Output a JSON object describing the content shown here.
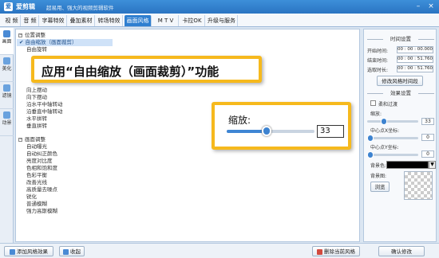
{
  "app": {
    "logo_char": "爱",
    "name": "爱剪辑",
    "slogan": "超易用、强大的视频剪辑软件",
    "min_symbol": "–",
    "close_symbol": "×"
  },
  "menu_tabs": [
    "视 频",
    "音 频",
    "字幕特效",
    "叠加素材",
    "转场特效",
    "画面风格",
    "M T V",
    "卡拉OK",
    "升级与服务"
  ],
  "active_menu_tab": "画面风格",
  "side_tabs": [
    {
      "label": "画面",
      "icon": "picture-icon"
    },
    {
      "label": "美化",
      "icon": "beautify-icon"
    },
    {
      "label": "滤镜",
      "icon": "filter-icon"
    },
    {
      "label": "动景",
      "icon": "motion-icon"
    }
  ],
  "effect_list": {
    "group1": {
      "label": "位置调整",
      "toggle": "−"
    },
    "selected_item": "自由缩放（画面裁剪）",
    "selected_check": "✔",
    "partial_item": "自由旋转",
    "group1_items": [
      "向上摆动",
      "向下摆动",
      "沿水平中轴转动",
      "沿垂直中轴转动",
      "水平拼转",
      "垂直拼转"
    ],
    "group2": {
      "label": "画面调整",
      "toggle": "−"
    },
    "group2_items": [
      "自动曝光",
      "自动纠正颜色",
      "亮度对比度",
      "色相和饱和度",
      "色彩平衡",
      "改善光线",
      "高质量去噪点",
      "锐化",
      "普通模糊",
      "强力高斯模糊"
    ]
  },
  "bottom_buttons": {
    "add_style": "添加风格效果",
    "collapse": "收起",
    "delete_style": "删除当前风格",
    "confirm": "确认修改"
  },
  "right_panel": {
    "time_section": "时间设置",
    "start_label": "开始时间:",
    "start_value": "00 : 00 : 00.000",
    "end_label": "结束时间:",
    "end_value": "00 : 00 : 51.760",
    "duration_label": "选取时长:",
    "duration_value": "00 : 00 : 51.760",
    "modify_time_btn": "修改风格时间段",
    "effect_section": "效果设置",
    "soft_transition": "柔和过渡",
    "zoom_label": "缩放:",
    "zoom_value": "33",
    "zoom_fraction": 0.33,
    "center_x_label": "中心点X坐标:",
    "center_x_value": "0",
    "center_y_label": "中心点Y坐标:",
    "center_y_value": "0",
    "bgcolor_label": "背景色:",
    "bgcolor_hex": "#000000",
    "bgimage_label": "背景图:",
    "browse_btn": "浏览"
  },
  "callout_title": "应用“自由缩放（画面裁剪）”功能",
  "callout_zoom": {
    "label": "缩放:",
    "value": "33",
    "fraction": 0.45
  },
  "colors": {
    "accent": "#2f7fd0",
    "highlight_border": "#f6b91d"
  }
}
